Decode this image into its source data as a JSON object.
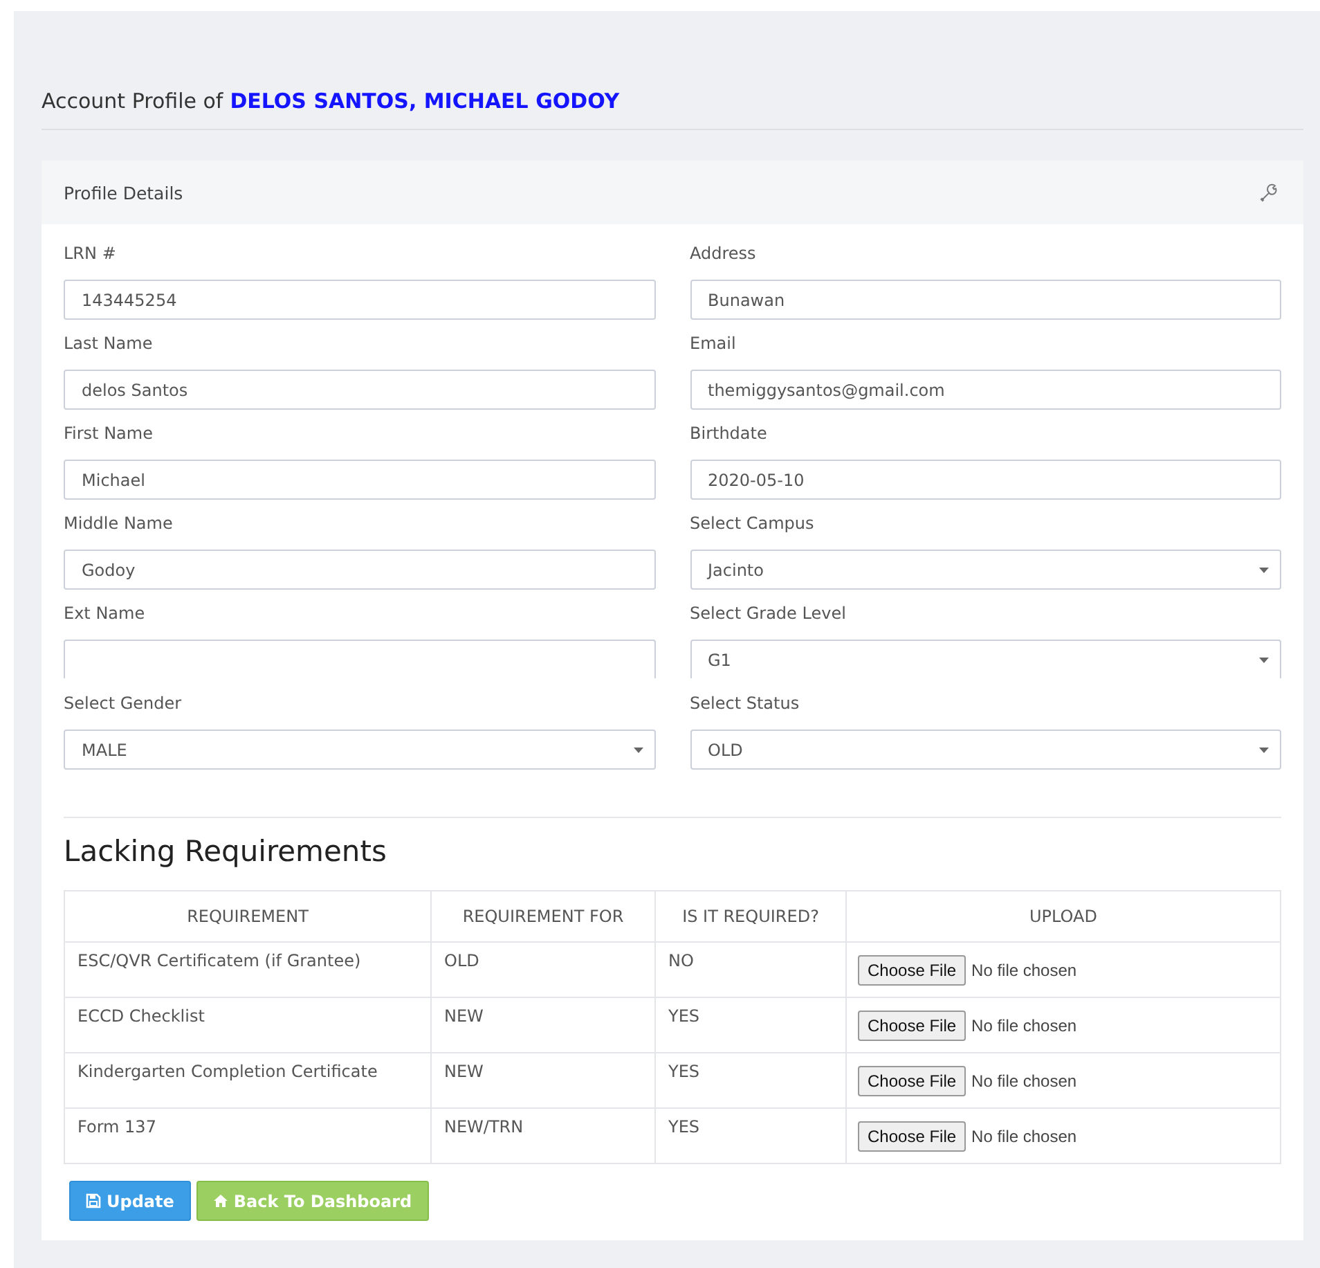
{
  "page_title": {
    "prefix": "Account Profile of",
    "name": "DELOS SANTOS, MICHAEL GODOY"
  },
  "card": {
    "title": "Profile Details"
  },
  "fields": [
    {
      "label": "LRN #",
      "kind": "text",
      "value": "143445254"
    },
    {
      "label": "Address",
      "kind": "text",
      "value": "Bunawan"
    },
    {
      "label": "Last Name",
      "kind": "text",
      "value": "delos Santos"
    },
    {
      "label": "Email",
      "kind": "text",
      "value": "themiggysantos@gmail.com"
    },
    {
      "label": "First Name",
      "kind": "text",
      "value": "Michael"
    },
    {
      "label": "Birthdate",
      "kind": "text",
      "value": "2020-05-10"
    },
    {
      "label": "Middle Name",
      "kind": "text",
      "value": "Godoy"
    },
    {
      "label": "Select Campus",
      "kind": "select",
      "value": "Jacinto"
    },
    {
      "label": "Ext Name",
      "kind": "text",
      "clipped": true
    },
    {
      "label": "Select Grade Level",
      "kind": "select",
      "value": "G1",
      "clipped": true
    },
    {
      "label": "Select Gender",
      "kind": "select",
      "value": "MALE"
    },
    {
      "label": "Select Status",
      "kind": "select",
      "value": "OLD"
    }
  ],
  "requirements": {
    "title": "Lacking Requirements",
    "columns": [
      "REQUIREMENT",
      "REQUIREMENT FOR",
      "IS IT REQUIRED?",
      "UPLOAD"
    ],
    "rows": [
      {
        "requirement": "ESC/QVR Certificatem (if Grantee)",
        "for": "OLD",
        "required": "NO",
        "upload_button": "Choose File",
        "upload_status": "No file chosen"
      },
      {
        "requirement": "ECCD Checklist",
        "for": "NEW",
        "required": "YES",
        "upload_button": "Choose File",
        "upload_status": "No file chosen"
      },
      {
        "requirement": "Kindergarten Completion Certificate",
        "for": "NEW",
        "required": "YES",
        "upload_button": "Choose File",
        "upload_status": "No file chosen"
      },
      {
        "requirement": "Form 137",
        "for": "NEW/TRN",
        "required": "YES",
        "upload_button": "Choose File",
        "upload_status": "No file chosen"
      }
    ]
  },
  "buttons": [
    {
      "label": "Update",
      "kind": "primary"
    },
    {
      "label": "Back To Dashboard",
      "kind": "success"
    }
  ]
}
